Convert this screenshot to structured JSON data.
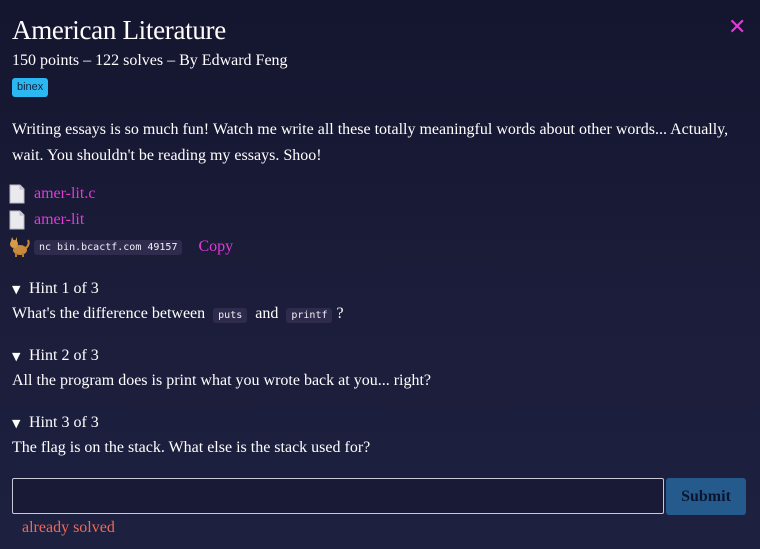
{
  "challenge": {
    "title": "American Literature",
    "meta": "150 points – 122 solves – By Edward Feng",
    "tag": "binex",
    "description": "Writing essays is so much fun! Watch me write all these totally meaningful words about other words... Actually, wait. You shouldn't be reading my essays. Shoo!"
  },
  "files": [
    {
      "name": "amer-lit.c",
      "icon": "file-icon"
    },
    {
      "name": "amer-lit",
      "icon": "file-icon"
    }
  ],
  "connection": {
    "icon": "cat-icon",
    "command": "nc bin.bcactf.com 49157",
    "copy_label": "Copy"
  },
  "hints": [
    {
      "header": "Hint 1 of 3",
      "parts": [
        "What's the difference between",
        "puts",
        "and",
        "printf",
        "?"
      ]
    },
    {
      "header": "Hint 2 of 3",
      "text": "All the program does is print what you wrote back at you... right?"
    },
    {
      "header": "Hint 3 of 3",
      "text": "The flag is on the stack. What else is the stack used for?"
    }
  ],
  "form": {
    "input_value": "",
    "placeholder": "",
    "submit_label": "Submit",
    "status": "already solved"
  },
  "colors": {
    "accent": "#e23ad9",
    "tag_bg": "#2bb7f1",
    "submit_bg": "#245a8c",
    "status": "#f06a56"
  }
}
